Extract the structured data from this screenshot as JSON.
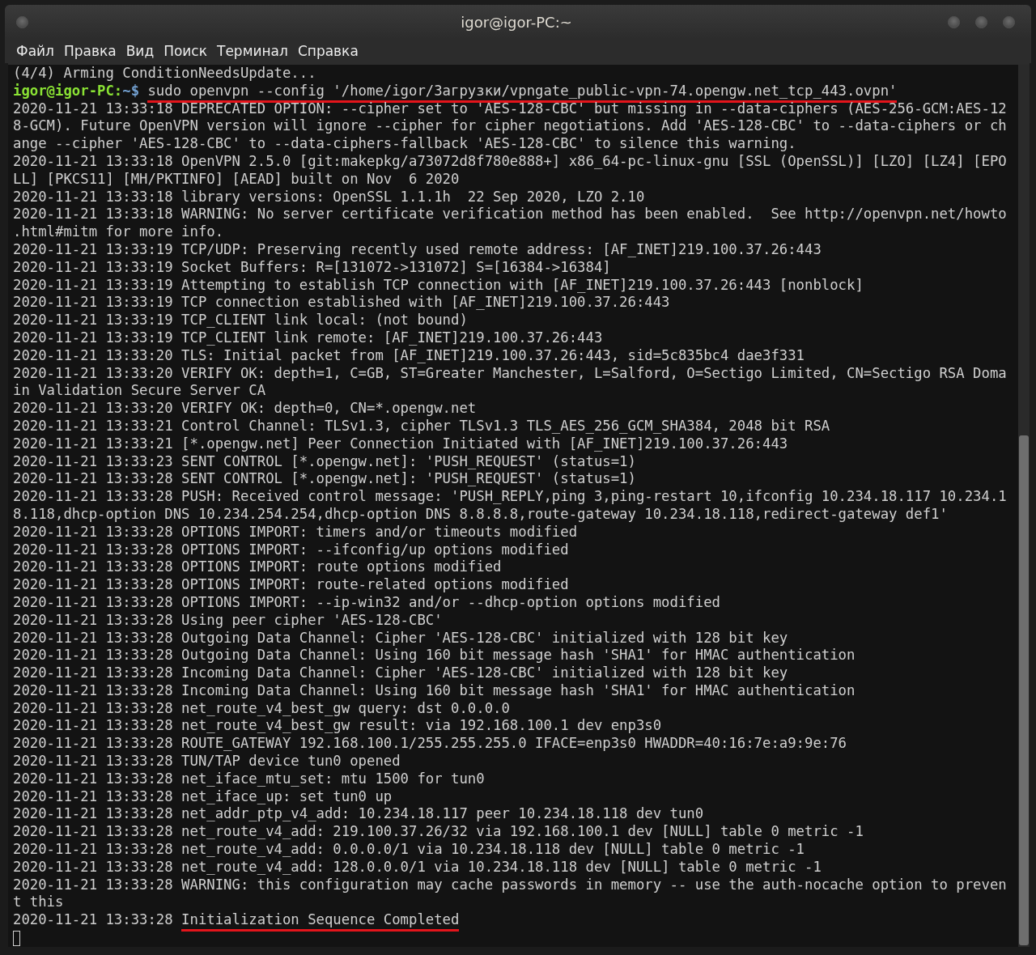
{
  "window": {
    "title": "igor@igor-PC:~"
  },
  "menu": [
    {
      "label": "Файл"
    },
    {
      "label": "Правка"
    },
    {
      "label": "Вид"
    },
    {
      "label": "Поиск"
    },
    {
      "label": "Терминал"
    },
    {
      "label": "Справка"
    }
  ],
  "terminal": {
    "cursor": true,
    "lines": [
      {
        "kind": "output",
        "text": "(4/4) Arming ConditionNeedsUpdate..."
      },
      {
        "kind": "prompt",
        "user_host": "igor@igor-PC:",
        "path": "~$",
        "command": "sudo openvpn --config '/home/igor/Загрузки/vpngate_public-vpn-74.opengw.net_tcp_443.ovpn'",
        "underlined": true
      },
      {
        "kind": "output",
        "text": "2020-11-21 13:33:18 DEPRECATED OPTION: --cipher set to 'AES-128-CBC' but missing in --data-ciphers (AES-256-GCM:AES-12"
      },
      {
        "kind": "output",
        "text": "8-GCM). Future OpenVPN version will ignore --cipher for cipher negotiations. Add 'AES-128-CBC' to --data-ciphers or ch"
      },
      {
        "kind": "output",
        "text": "ange --cipher 'AES-128-CBC' to --data-ciphers-fallback 'AES-128-CBC' to silence this warning."
      },
      {
        "kind": "output",
        "text": "2020-11-21 13:33:18 OpenVPN 2.5.0 [git:makepkg/a73072d8f780e888+] x86_64-pc-linux-gnu [SSL (OpenSSL)] [LZO] [LZ4] [EPO"
      },
      {
        "kind": "output",
        "text": "LL] [PKCS11] [MH/PKTINFO] [AEAD] built on Nov  6 2020"
      },
      {
        "kind": "output",
        "text": "2020-11-21 13:33:18 library versions: OpenSSL 1.1.1h  22 Sep 2020, LZO 2.10"
      },
      {
        "kind": "output",
        "text": "2020-11-21 13:33:18 WARNING: No server certificate verification method has been enabled.  See http://openvpn.net/howto"
      },
      {
        "kind": "output",
        "text": ".html#mitm for more info."
      },
      {
        "kind": "output",
        "text": "2020-11-21 13:33:19 TCP/UDP: Preserving recently used remote address: [AF_INET]219.100.37.26:443"
      },
      {
        "kind": "output",
        "text": "2020-11-21 13:33:19 Socket Buffers: R=[131072->131072] S=[16384->16384]"
      },
      {
        "kind": "output",
        "text": "2020-11-21 13:33:19 Attempting to establish TCP connection with [AF_INET]219.100.37.26:443 [nonblock]"
      },
      {
        "kind": "output",
        "text": "2020-11-21 13:33:19 TCP connection established with [AF_INET]219.100.37.26:443"
      },
      {
        "kind": "output",
        "text": "2020-11-21 13:33:19 TCP_CLIENT link local: (not bound)"
      },
      {
        "kind": "output",
        "text": "2020-11-21 13:33:19 TCP_CLIENT link remote: [AF_INET]219.100.37.26:443"
      },
      {
        "kind": "output",
        "text": "2020-11-21 13:33:20 TLS: Initial packet from [AF_INET]219.100.37.26:443, sid=5c835bc4 dae3f331"
      },
      {
        "kind": "output",
        "text": "2020-11-21 13:33:20 VERIFY OK: depth=1, C=GB, ST=Greater Manchester, L=Salford, O=Sectigo Limited, CN=Sectigo RSA Doma"
      },
      {
        "kind": "output",
        "text": "in Validation Secure Server CA"
      },
      {
        "kind": "output",
        "text": "2020-11-21 13:33:20 VERIFY OK: depth=0, CN=*.opengw.net"
      },
      {
        "kind": "output",
        "text": "2020-11-21 13:33:21 Control Channel: TLSv1.3, cipher TLSv1.3 TLS_AES_256_GCM_SHA384, 2048 bit RSA"
      },
      {
        "kind": "output",
        "text": "2020-11-21 13:33:21 [*.opengw.net] Peer Connection Initiated with [AF_INET]219.100.37.26:443"
      },
      {
        "kind": "output",
        "text": "2020-11-21 13:33:23 SENT CONTROL [*.opengw.net]: 'PUSH_REQUEST' (status=1)"
      },
      {
        "kind": "output",
        "text": "2020-11-21 13:33:28 SENT CONTROL [*.opengw.net]: 'PUSH_REQUEST' (status=1)"
      },
      {
        "kind": "output",
        "text": "2020-11-21 13:33:28 PUSH: Received control message: 'PUSH_REPLY,ping 3,ping-restart 10,ifconfig 10.234.18.117 10.234.1"
      },
      {
        "kind": "output",
        "text": "8.118,dhcp-option DNS 10.234.254.254,dhcp-option DNS 8.8.8.8,route-gateway 10.234.18.118,redirect-gateway def1'"
      },
      {
        "kind": "output",
        "text": "2020-11-21 13:33:28 OPTIONS IMPORT: timers and/or timeouts modified"
      },
      {
        "kind": "output",
        "text": "2020-11-21 13:33:28 OPTIONS IMPORT: --ifconfig/up options modified"
      },
      {
        "kind": "output",
        "text": "2020-11-21 13:33:28 OPTIONS IMPORT: route options modified"
      },
      {
        "kind": "output",
        "text": "2020-11-21 13:33:28 OPTIONS IMPORT: route-related options modified"
      },
      {
        "kind": "output",
        "text": "2020-11-21 13:33:28 OPTIONS IMPORT: --ip-win32 and/or --dhcp-option options modified"
      },
      {
        "kind": "output",
        "text": "2020-11-21 13:33:28 Using peer cipher 'AES-128-CBC'"
      },
      {
        "kind": "output",
        "text": "2020-11-21 13:33:28 Outgoing Data Channel: Cipher 'AES-128-CBC' initialized with 128 bit key"
      },
      {
        "kind": "output",
        "text": "2020-11-21 13:33:28 Outgoing Data Channel: Using 160 bit message hash 'SHA1' for HMAC authentication"
      },
      {
        "kind": "output",
        "text": "2020-11-21 13:33:28 Incoming Data Channel: Cipher 'AES-128-CBC' initialized with 128 bit key"
      },
      {
        "kind": "output",
        "text": "2020-11-21 13:33:28 Incoming Data Channel: Using 160 bit message hash 'SHA1' for HMAC authentication"
      },
      {
        "kind": "output",
        "text": "2020-11-21 13:33:28 net_route_v4_best_gw query: dst 0.0.0.0"
      },
      {
        "kind": "output",
        "text": "2020-11-21 13:33:28 net_route_v4_best_gw result: via 192.168.100.1 dev enp3s0"
      },
      {
        "kind": "output",
        "text": "2020-11-21 13:33:28 ROUTE_GATEWAY 192.168.100.1/255.255.255.0 IFACE=enp3s0 HWADDR=40:16:7e:a9:9e:76"
      },
      {
        "kind": "output",
        "text": "2020-11-21 13:33:28 TUN/TAP device tun0 opened"
      },
      {
        "kind": "output",
        "text": "2020-11-21 13:33:28 net_iface_mtu_set: mtu 1500 for tun0"
      },
      {
        "kind": "output",
        "text": "2020-11-21 13:33:28 net_iface_up: set tun0 up"
      },
      {
        "kind": "output",
        "text": "2020-11-21 13:33:28 net_addr_ptp_v4_add: 10.234.18.117 peer 10.234.18.118 dev tun0"
      },
      {
        "kind": "output",
        "text": "2020-11-21 13:33:28 net_route_v4_add: 219.100.37.26/32 via 192.168.100.1 dev [NULL] table 0 metric -1"
      },
      {
        "kind": "output",
        "text": "2020-11-21 13:33:28 net_route_v4_add: 0.0.0.0/1 via 10.234.18.118 dev [NULL] table 0 metric -1"
      },
      {
        "kind": "output",
        "text": "2020-11-21 13:33:28 net_route_v4_add: 128.0.0.0/1 via 10.234.18.118 dev [NULL] table 0 metric -1"
      },
      {
        "kind": "output",
        "text": "2020-11-21 13:33:28 WARNING: this configuration may cache passwords in memory -- use the auth-nocache option to preven"
      },
      {
        "kind": "output",
        "text": "t this"
      },
      {
        "kind": "marked",
        "prefix": "2020-11-21 13:33:28",
        "text": "Initialization Sequence Completed",
        "underlined": true
      }
    ]
  }
}
